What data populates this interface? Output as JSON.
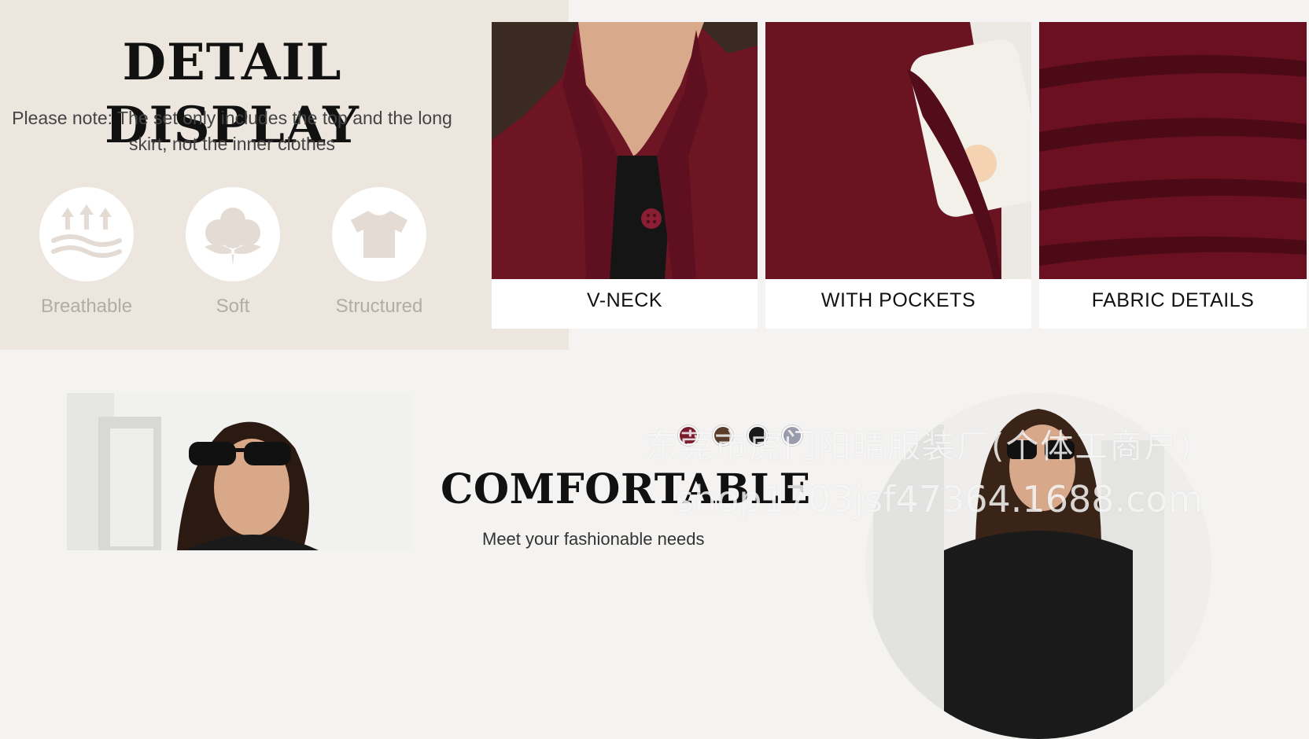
{
  "detail_section": {
    "title": "DETAIL DISPLAY",
    "note": "Please note: The set only includes the top and the long skirt, not the inner clothes",
    "features": [
      {
        "label": "Breathable",
        "icon": "breathable-icon"
      },
      {
        "label": "Soft",
        "icon": "cotton-flower-icon"
      },
      {
        "label": "Structured",
        "icon": "tshirt-icon"
      }
    ]
  },
  "detail_tiles": [
    {
      "caption": "V-NECK"
    },
    {
      "caption": "WITH POCKETS"
    },
    {
      "caption": "FABRIC DETAILS"
    }
  ],
  "comfort_section": {
    "title": "COMFORTABLE",
    "subtitle": "Meet your fashionable needs",
    "swatch_colors": [
      "#7a1a2c",
      "#5a3d2b",
      "#1a1a1a",
      "#9a9cab"
    ]
  },
  "watermark": {
    "line1": "东莞市虎门阳晴服装厂(个体工商户)",
    "line2": "shop1703jsf47364.1688.com"
  },
  "colors": {
    "panel_bg": "#ede6df",
    "burgundy": "#7a1a2c",
    "feature_label": "#b3aca5"
  }
}
